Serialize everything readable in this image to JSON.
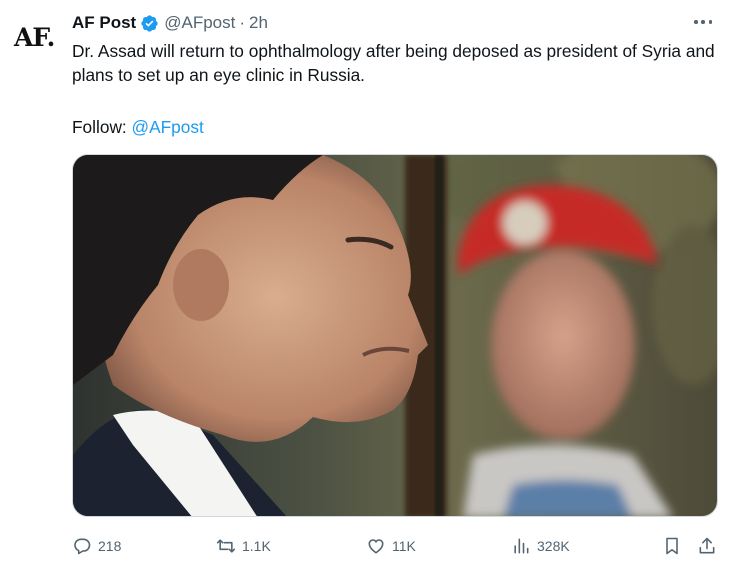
{
  "author": {
    "avatar_text": "AF.",
    "name": "AF Post",
    "handle": "@AFpost",
    "separator": "·",
    "time": "2h"
  },
  "tweet": {
    "text": "Dr. Assad will return to ophthalmology after being deposed as president of Syria and plans to set up an eye clinic in Russia.",
    "follow_label": "Follow: ",
    "follow_link": "@AFpost"
  },
  "stats": {
    "replies": "218",
    "reposts": "1.1K",
    "likes": "11K",
    "views": "328K"
  },
  "icons": {
    "verified": "verified-badge-icon",
    "more": "more-icon",
    "reply": "reply-icon",
    "repost": "repost-icon",
    "like": "heart-icon",
    "views": "views-icon",
    "bookmark": "bookmark-icon",
    "share": "share-icon"
  },
  "colors": {
    "accent": "#1d9bf0",
    "text": "#0f1419",
    "muted": "#536471"
  }
}
